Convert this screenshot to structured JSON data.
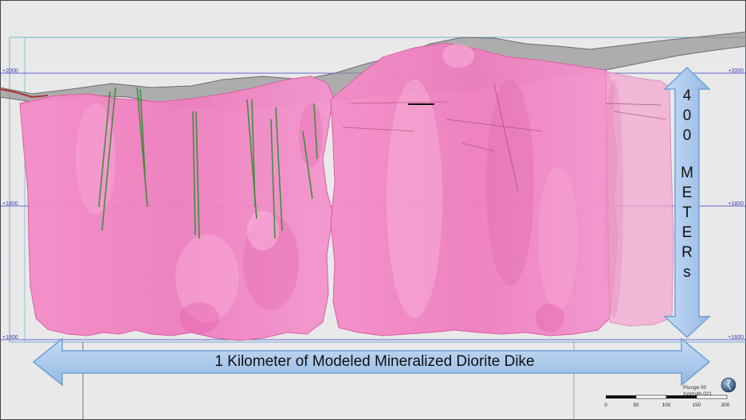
{
  "elevation_labels": {
    "e2000": "+2000",
    "e1800": "+1800",
    "e1600": "+1600"
  },
  "horizontal_arrow_label": "1 Kilometer of Modeled Mineralized Diorite Dike",
  "vertical_arrow_label": {
    "number_chars": [
      "4",
      "0",
      "0"
    ],
    "word_chars": [
      "M",
      "E",
      "T",
      "E",
      "R",
      "s"
    ]
  },
  "view_orientation": {
    "plunge": "Plunge 00",
    "azimuth": "Azimuth 021"
  },
  "compass_icon": "compass-globe-icon",
  "scale_bar": {
    "ticks": [
      "0",
      "50",
      "100",
      "150",
      "200"
    ]
  },
  "colors": {
    "background": "#e9e9e9",
    "dike_pink": "#f07fc0",
    "arrow_blue": "#a9c8ec",
    "arrow_border": "#6f9fd6",
    "grid_blue": "#3d3dc4",
    "topo_grey": "#7a7a7a",
    "drillhole_green": "#3e8f3e"
  }
}
